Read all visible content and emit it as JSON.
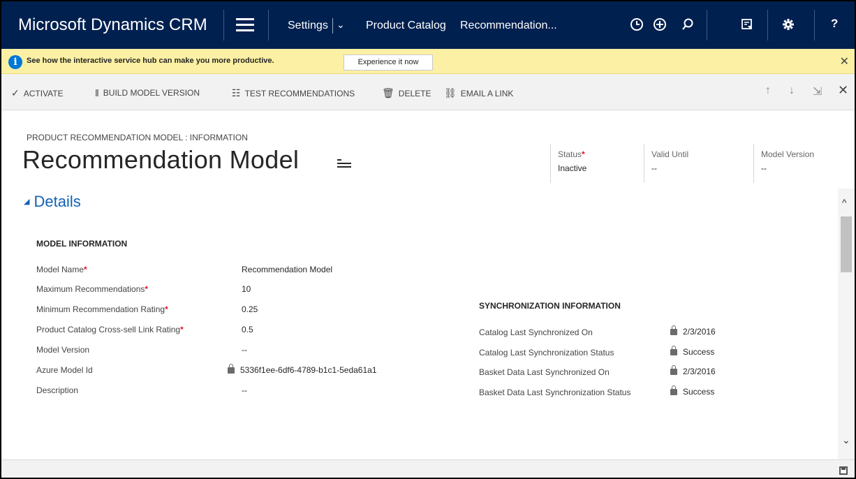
{
  "app": {
    "title": "Microsoft Dynamics CRM",
    "nav": {
      "settings_label": "Settings",
      "chevron": "⌄",
      "breadcrumb_1": "Product Catalog",
      "breadcrumb_2": "Recommendation...",
      "icons": [
        "clock-icon",
        "plus-circle-icon",
        "search-icon",
        "advanced-find-icon",
        "gear-icon",
        "help-icon"
      ],
      "help_label": "?"
    }
  },
  "infobar": {
    "text": "See how the interactive service hub can make you more productive.",
    "button_label": "Experience it now",
    "close_label": "✕"
  },
  "commands": {
    "activate": "ACTIVATE",
    "build_model_version": "BUILD MODEL VERSION",
    "test_recommendations": "TEST RECOMMENDATIONS",
    "delete": "DELETE",
    "email_link": "EMAIL A LINK",
    "up": "↑",
    "down": "↓",
    "expand": "⇲",
    "close": "✕"
  },
  "record": {
    "entity_type": "PRODUCT RECOMMENDATION MODEL : INFORMATION",
    "title": "Recommendation Model",
    "header_fields": {
      "status_label": "Status",
      "status_value": "Inactive",
      "valid_until_label": "Valid Until",
      "valid_until_value": "--",
      "model_version_label": "Model Version",
      "model_version_value": "--"
    }
  },
  "details": {
    "section_label": "Details",
    "model_info": {
      "title": "MODEL INFORMATION",
      "fields": [
        {
          "label": "Model Name",
          "value": "Recommendation Model"
        },
        {
          "label": "Maximum Recommendations",
          "value": "10"
        },
        {
          "label": "Minimum Recommendation Rating",
          "value": "0.25"
        },
        {
          "label": "Product Catalog Cross-sell Link Rating",
          "value": "0.5"
        },
        {
          "label": "Model Version",
          "value": "--"
        },
        {
          "label": "Azure Model Id",
          "value": "5336f1ee-6df6-4789-b1c1-5eda61a1"
        },
        {
          "label": "Description",
          "value": "--"
        }
      ]
    },
    "sync_info": {
      "title": "SYNCHRONIZATION INFORMATION",
      "fields": [
        {
          "label": "Catalog Last Synchronized On",
          "value": "2/3/2016"
        },
        {
          "label": "Catalog Last Synchronization Status",
          "value": "Success"
        },
        {
          "label": "Basket Data Last Synchronized On",
          "value": "2/3/2016"
        },
        {
          "label": "Basket Data Last Synchronization Status",
          "value": "Success"
        }
      ]
    },
    "required_marker": "*"
  },
  "scroll": {
    "up": "^",
    "down": "⌄"
  },
  "colors": {
    "nav_bg": "#002050",
    "infobar_bg": "#fcf0a4",
    "accent_blue": "#1160b7",
    "required_red": "#e81123"
  }
}
